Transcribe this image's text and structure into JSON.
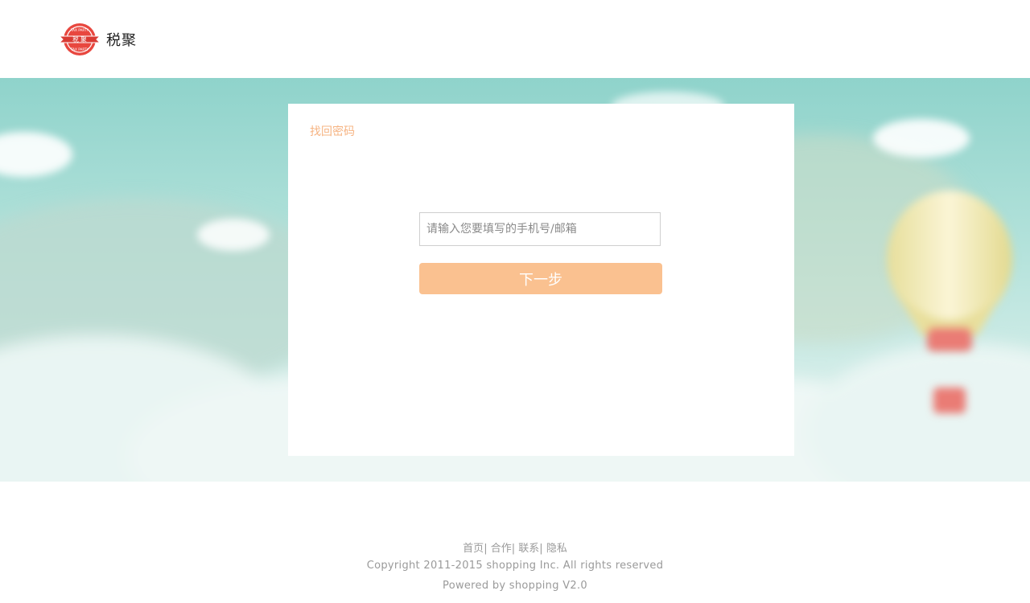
{
  "header": {
    "brand_name": "税聚",
    "seal_text_top": "TAX PARTY",
    "seal_text_center": "税 聚",
    "seal_text_bottom": "TAX PARTY"
  },
  "card": {
    "title": "找回密码",
    "account_input": {
      "value": "",
      "placeholder": "请输入您要填写的手机号/邮箱"
    },
    "next_button_label": "下一步"
  },
  "footer": {
    "links": [
      {
        "label": "首页"
      },
      {
        "label": "合作"
      },
      {
        "label": "联系"
      },
      {
        "label": "隐私"
      }
    ],
    "separator": "|",
    "copyright": "Copyright 2011-2015 shopping Inc. All rights reserved",
    "powered": "Powered by shopping V2.0"
  },
  "colors": {
    "accent": "#fac190",
    "title_orange": "#f6b483",
    "logo_red": "#e8473f",
    "hero_teal": "#8fd3cb",
    "footer_text": "#9a9a9a"
  },
  "icons": {
    "logo": "tax-party-seal-icon",
    "balloon": "hot-air-balloon-illustration"
  }
}
